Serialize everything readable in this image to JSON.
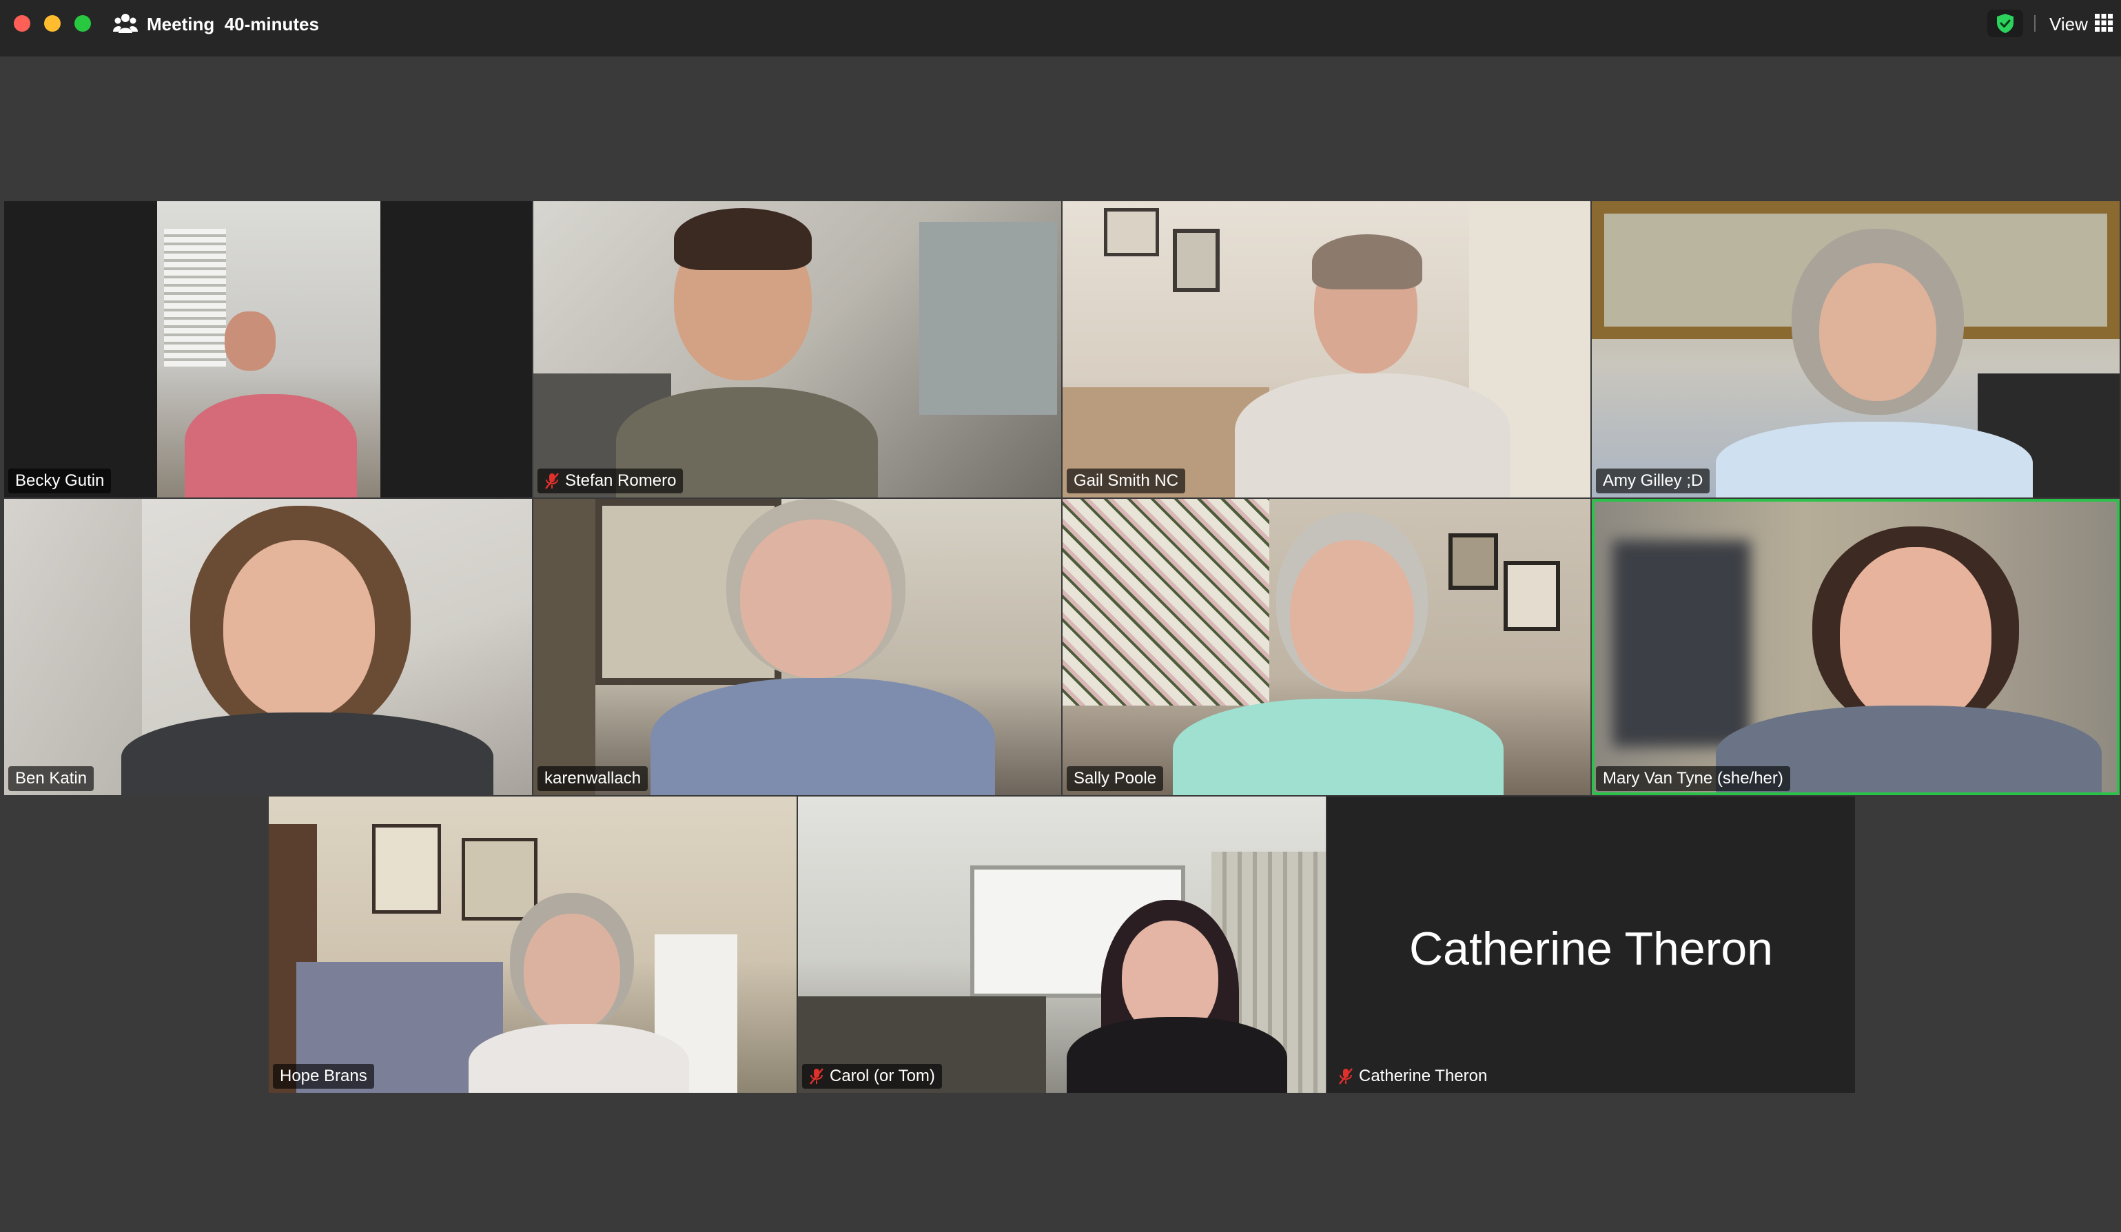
{
  "window": {
    "meeting_label": "Meeting",
    "meeting_timer": "40-minutes",
    "view_label": "View"
  },
  "colors": {
    "active_speaker_border": "#29c34a",
    "mute_icon": "#e0302b",
    "shield": "#2bd35d"
  },
  "participants": [
    {
      "name": "Becky Gutin",
      "muted": false
    },
    {
      "name": "Stefan Romero",
      "muted": true
    },
    {
      "name": "Gail Smith NC",
      "muted": false
    },
    {
      "name": "Amy Gilley ;D",
      "muted": false
    },
    {
      "name": "Ben Katin",
      "muted": false
    },
    {
      "name": "karenwallach",
      "muted": false
    },
    {
      "name": "Sally Poole",
      "muted": false
    },
    {
      "name": "Mary Van Tyne (she/her)",
      "muted": false,
      "active_speaker": true
    },
    {
      "name": "Hope Brans",
      "muted": false
    },
    {
      "name": "Carol (or Tom)",
      "muted": true
    },
    {
      "name": "Catherine Theron",
      "muted": true,
      "video_off": true
    }
  ]
}
